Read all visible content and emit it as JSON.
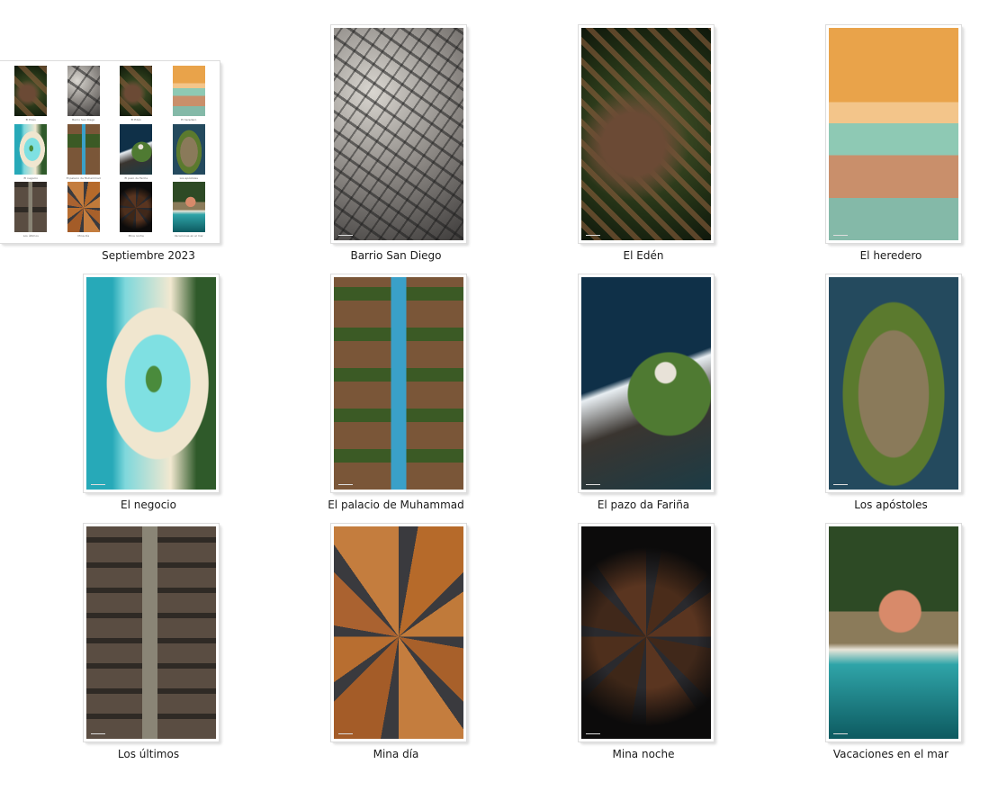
{
  "folders": [
    {
      "id": "sep2023",
      "label": "Septiembre 2023",
      "art": "sheet"
    },
    {
      "id": "barrio",
      "label": "Barrio San Diego",
      "art": "a-city"
    },
    {
      "id": "eden",
      "label": "El Edén",
      "art": "a-eden"
    },
    {
      "id": "heredero",
      "label": "El heredero",
      "art": "a-heredero"
    },
    {
      "id": "negocio",
      "label": "El negocio",
      "art": "a-negocio"
    },
    {
      "id": "palacio",
      "label": "El palacio de Muhammad",
      "art": "a-palacio"
    },
    {
      "id": "pazo",
      "label": "El pazo da Fariña",
      "art": "a-pazo"
    },
    {
      "id": "apostoles",
      "label": "Los apóstoles",
      "art": "a-apostoles"
    },
    {
      "id": "ultimos",
      "label": "Los últimos",
      "art": "a-ultimos"
    },
    {
      "id": "minadia",
      "label": "Mina día",
      "art": "a-minadia"
    },
    {
      "id": "minanoche",
      "label": "Mina noche",
      "art": "a-minanoche"
    },
    {
      "id": "vacaciones",
      "label": "Vacaciones en el mar",
      "art": "a-vacaciones"
    }
  ],
  "contact_sheet": [
    {
      "label": "El Edén",
      "art": "a-eden"
    },
    {
      "label": "Barrio San Diego",
      "art": "a-city"
    },
    {
      "label": "El Edén",
      "art": "a-eden"
    },
    {
      "label": "El heredero",
      "art": "a-heredero"
    },
    {
      "label": "El negocio",
      "art": "a-negocio"
    },
    {
      "label": "El palacio de Muhammad",
      "art": "a-palacio"
    },
    {
      "label": "El pazo da Fariña",
      "art": "a-pazo"
    },
    {
      "label": "Los apóstoles",
      "art": "a-apostoles"
    },
    {
      "label": "Los últimos",
      "art": "a-ultimos"
    },
    {
      "label": "Mina día",
      "art": "a-minadia"
    },
    {
      "label": "Mina noche",
      "art": "a-minanoche"
    },
    {
      "label": "Vacaciones en el mar",
      "art": "a-vacaciones"
    }
  ]
}
